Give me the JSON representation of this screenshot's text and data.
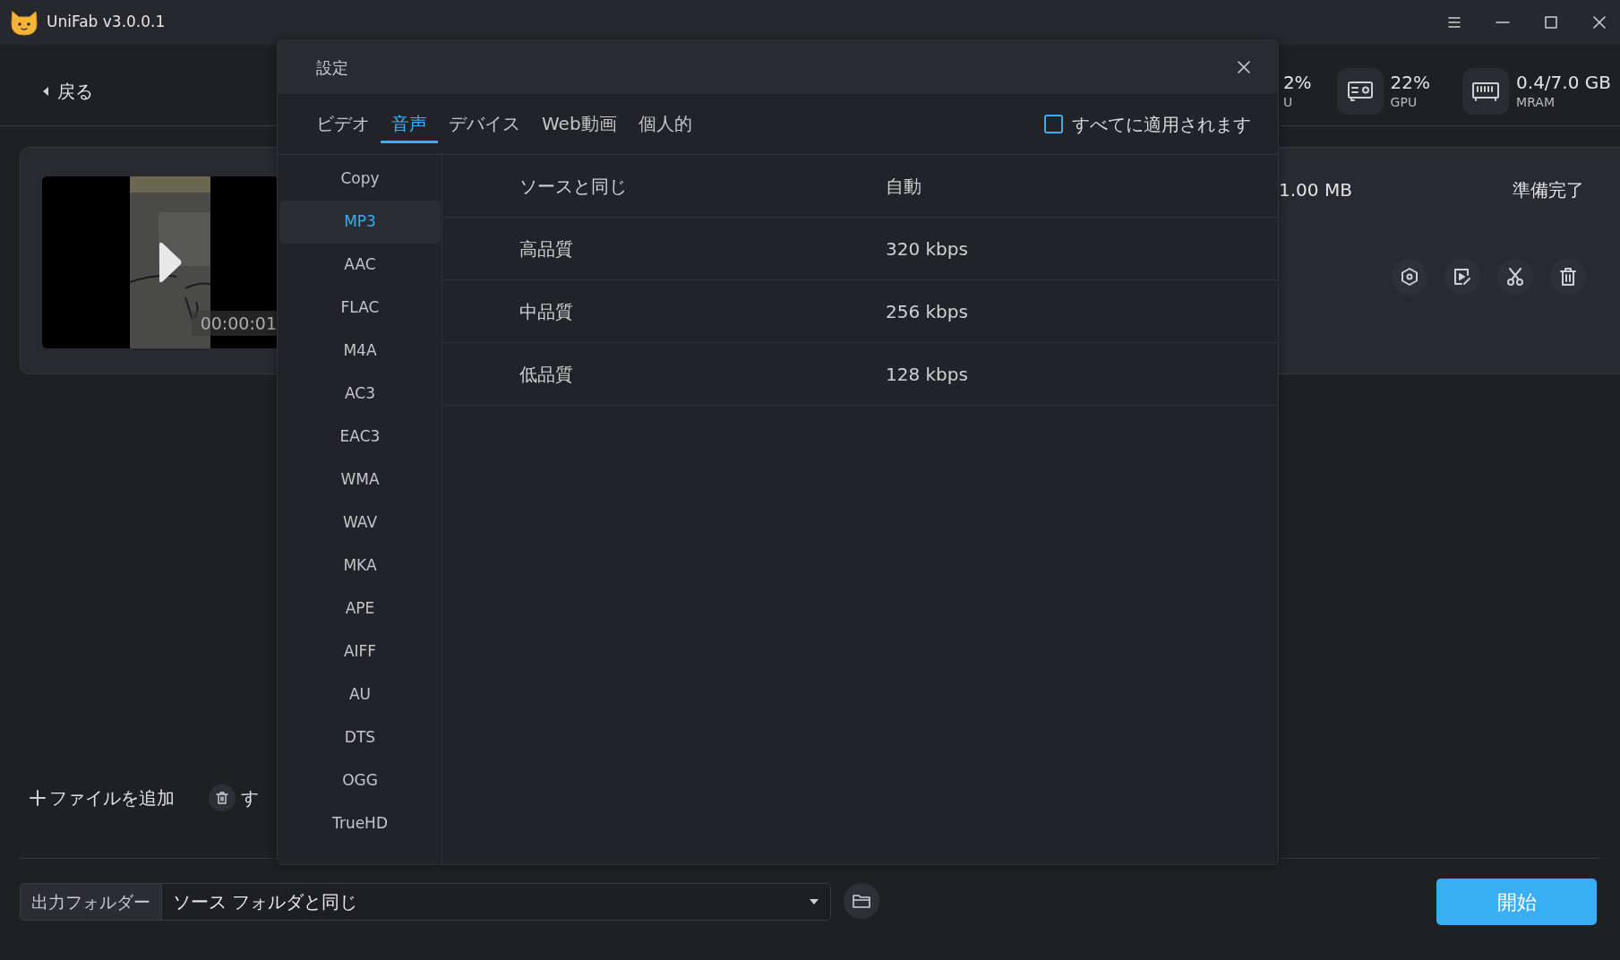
{
  "window": {
    "title": "UniFab v3.0.0.1"
  },
  "header": {
    "back": "戻る",
    "stats": [
      {
        "kind": "cpu",
        "value": "2%",
        "label": "U"
      },
      {
        "kind": "gpu",
        "value": "22%",
        "label": "GPU"
      },
      {
        "kind": "ram",
        "value": "0.4/7.0 GB",
        "label": "MRAM"
      }
    ]
  },
  "file": {
    "duration": "00:00:01",
    "size": "1.00 MB",
    "status": "準備完了"
  },
  "add_file": "ファイルを追加",
  "clear_all": "す",
  "output": {
    "label": "出力フォルダー",
    "value": "ソース フォルダと同じ"
  },
  "start": "開始",
  "dialog": {
    "title": "設定",
    "tabs": [
      {
        "label": "ビデオ",
        "selected": false
      },
      {
        "label": "音声",
        "selected": true
      },
      {
        "label": "デバイス",
        "selected": false
      },
      {
        "label": "Web動画",
        "selected": false
      },
      {
        "label": "個人的",
        "selected": false
      }
    ],
    "apply_all": {
      "label": "すべてに適用されます",
      "checked": false
    },
    "formats": [
      {
        "label": "Copy",
        "selected": false
      },
      {
        "label": "MP3",
        "selected": true
      },
      {
        "label": "AAC",
        "selected": false
      },
      {
        "label": "FLAC",
        "selected": false
      },
      {
        "label": "M4A",
        "selected": false
      },
      {
        "label": "AC3",
        "selected": false
      },
      {
        "label": "EAC3",
        "selected": false
      },
      {
        "label": "WMA",
        "selected": false
      },
      {
        "label": "WAV",
        "selected": false
      },
      {
        "label": "MKA",
        "selected": false
      },
      {
        "label": "APE",
        "selected": false
      },
      {
        "label": "AIFF",
        "selected": false
      },
      {
        "label": "AU",
        "selected": false
      },
      {
        "label": "DTS",
        "selected": false
      },
      {
        "label": "OGG",
        "selected": false
      },
      {
        "label": "TrueHD",
        "selected": false
      }
    ],
    "presets": [
      {
        "quality": "ソースと同じ",
        "bitrate": "自動"
      },
      {
        "quality": "高品質",
        "bitrate": "320 kbps"
      },
      {
        "quality": "中品質",
        "bitrate": "256 kbps"
      },
      {
        "quality": "低品質",
        "bitrate": "128 kbps"
      }
    ]
  }
}
